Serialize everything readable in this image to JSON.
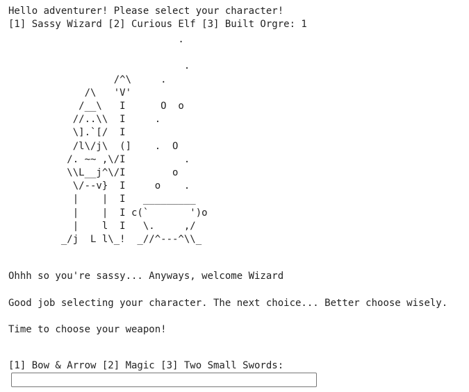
{
  "intro": {
    "greeting": "Hello adventurer! Please select your character!",
    "character_menu": "[1] Sassy Wizard [2] Curious Elf [3] Built Orgre: 1"
  },
  "ascii_art": "                             .\n\n                              .\n                  /^\\     .\n             /\\   'V'\n            /__\\   I      O  o\n           //..\\\\  I     .\n           \\].`[/  I\n           /l\\/j\\  (]    .  O\n          /. ~~ ,\\/I          .\n          \\\\L__j^\\/I        o\n           \\/--v}  I     o    .\n           |    |  I   _________\n           |    |  I c(`       ')o\n           |    l  I   \\.     ,/\n         _/j  L l\\_!  _//^---^\\\\_",
  "story": {
    "sassy_response": "Ohhh so you're sassy... Anyways, welcome Wizard",
    "next_choice": "Good job selecting your character. The next choice... Better choose wisely.",
    "weapon_prompt": "Time to choose your weapon!",
    "weapon_menu": "[1] Bow & Arrow [2] Magic [3] Two Small Swords:"
  },
  "input": {
    "value": "",
    "placeholder": ""
  }
}
